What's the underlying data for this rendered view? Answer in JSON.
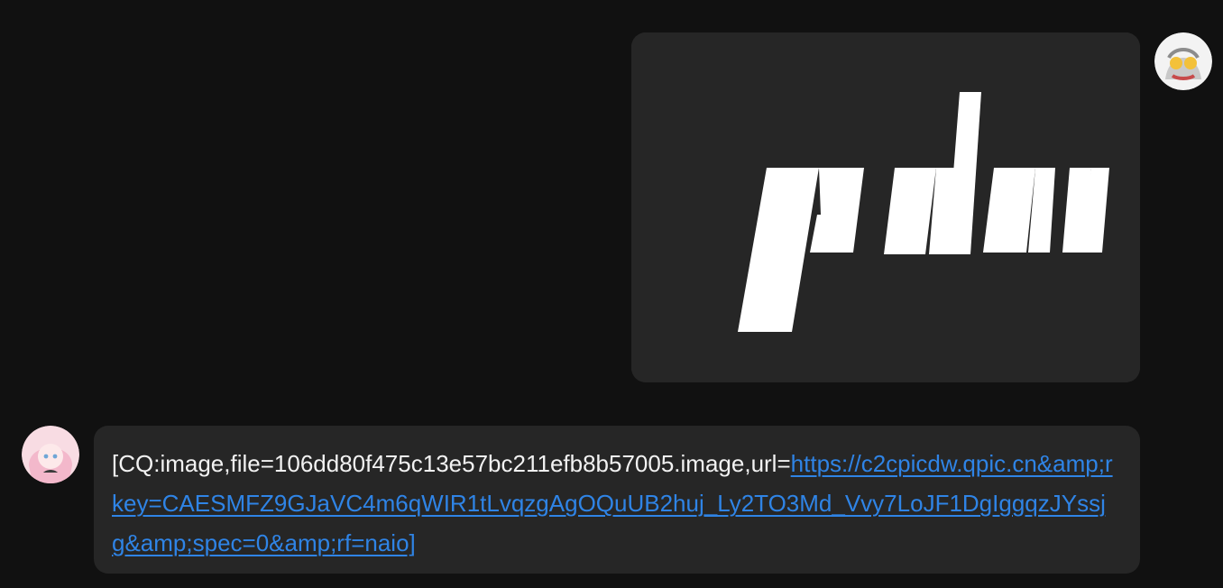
{
  "chat": {
    "outgoing": {
      "avatar_icon": "cartoon-hero-icon",
      "image_logo_icon": "palan-logo-image"
    },
    "incoming": {
      "avatar_icon": "anime-girl-icon",
      "text_prefix": "[CQ:image,file=106dd80f475c13e57bc211efb8b57005.image,url=",
      "link_text": "https://c2cpicdw.qpic.cn&amp;rkey=CAESMFZ9GJaVC4m6qWIR1tLvqzgAgOQuUB2huj_Ly2TO3Md_Vvy7LoJF1DgIggqzJYssjg&amp;spec=0&amp;rf=naio]"
    }
  },
  "colors": {
    "background": "#111111",
    "bubble": "#262626",
    "text": "#f2f2f2",
    "link": "#2f84e6"
  }
}
